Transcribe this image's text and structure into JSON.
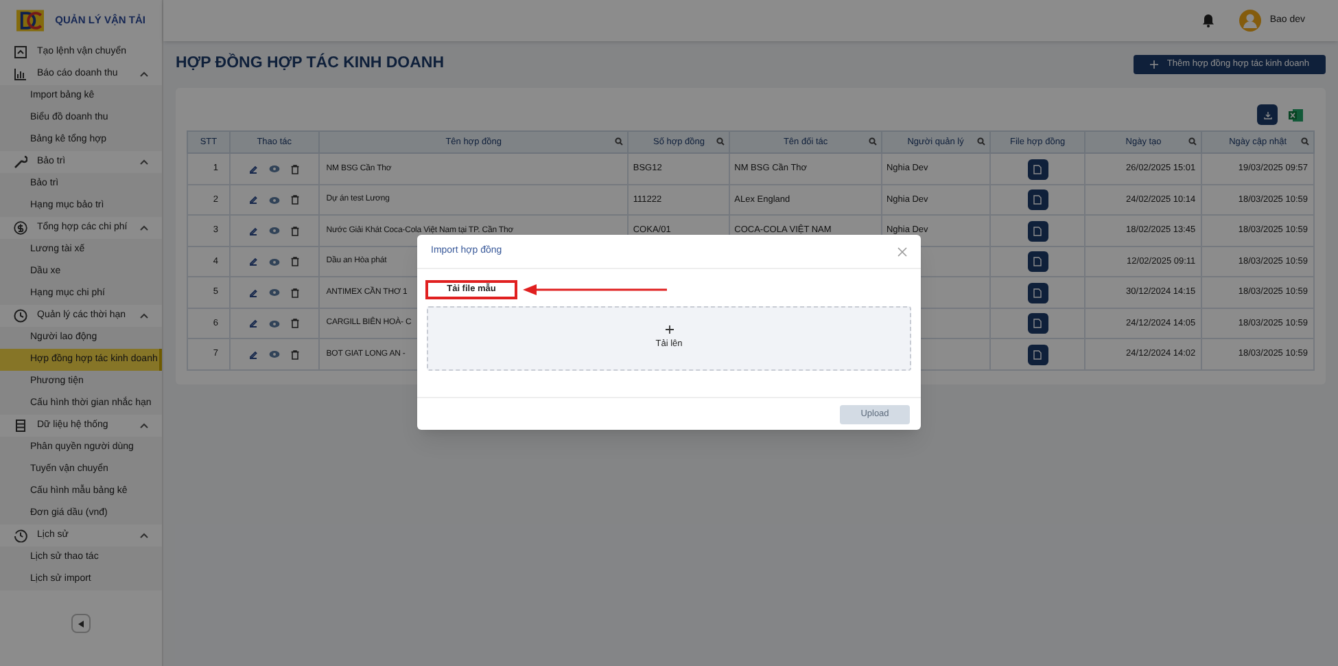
{
  "header": {
    "app_title": "QUẢN LÝ VẬN TẢI",
    "user_name": "Bao dev"
  },
  "sidebar": {
    "items": [
      {
        "kind": "link",
        "label": "Tạo lệnh vận chuyển"
      },
      {
        "kind": "group",
        "label": "Báo cáo doanh thu",
        "expanded": true,
        "children": [
          {
            "label": "Import bảng kê",
            "selected": false
          },
          {
            "label": "Biểu đồ doanh thu",
            "selected": false
          },
          {
            "label": "Bảng kê tổng hợp",
            "selected": false
          }
        ]
      },
      {
        "kind": "group",
        "label": "Bảo trì",
        "expanded": true,
        "children": [
          {
            "label": "Bảo trì",
            "selected": false
          },
          {
            "label": "Hạng mục bảo trì",
            "selected": false
          }
        ]
      },
      {
        "kind": "group",
        "label": "Tổng hợp các chi phí",
        "expanded": true,
        "children": [
          {
            "label": "Lương tài xế",
            "selected": false
          },
          {
            "label": "Dầu xe",
            "selected": false
          },
          {
            "label": "Hạng mục chi phí",
            "selected": false
          }
        ]
      },
      {
        "kind": "group",
        "label": "Quản lý các thời hạn",
        "expanded": true,
        "children": [
          {
            "label": "Người lao động",
            "selected": false
          },
          {
            "label": "Hợp đồng hợp tác kinh doanh",
            "selected": true
          },
          {
            "label": "Phương tiện",
            "selected": false
          },
          {
            "label": "Cấu hình thời gian nhắc hạn",
            "selected": false
          }
        ]
      },
      {
        "kind": "group",
        "label": "Dữ liệu hệ thống",
        "expanded": true,
        "children": [
          {
            "label": "Phân quyền người dùng",
            "selected": false
          },
          {
            "label": "Tuyến vận chuyển",
            "selected": false
          },
          {
            "label": "Cấu hình mẫu bảng kê",
            "selected": false
          },
          {
            "label": "Đơn giá dầu (vnđ)",
            "selected": false
          }
        ]
      },
      {
        "kind": "group",
        "label": "Lịch sử",
        "expanded": true,
        "children": [
          {
            "label": "Lịch sử thao tác",
            "selected": false
          },
          {
            "label": "Lịch sử import",
            "selected": false
          }
        ]
      }
    ]
  },
  "page_title": "HỢP ĐỒNG HỢP TÁC KINH DOANH",
  "add_button": "Thêm hợp đồng hợp tác kinh doanh",
  "table": {
    "columns": [
      {
        "label": "STT",
        "search": false
      },
      {
        "label": "Thao tác",
        "search": false
      },
      {
        "label": "Tên hợp đồng",
        "search": true
      },
      {
        "label": "Số hợp đồng",
        "search": true
      },
      {
        "label": "Tên đối tác",
        "search": true
      },
      {
        "label": "Người quản lý",
        "search": true
      },
      {
        "label": "File hợp đồng",
        "search": false
      },
      {
        "label": "Ngày tạo",
        "search": true
      },
      {
        "label": "Ngày cập nhật",
        "search": true
      }
    ],
    "rows": [
      {
        "stt": "1",
        "name": "NM BSG Cần Thơ",
        "number": "BSG12",
        "partner": "NM BSG Cần Thơ",
        "manager": "Nghia Dev",
        "created": "26/02/2025 15:01",
        "updated": "19/03/2025 09:57"
      },
      {
        "stt": "2",
        "name": "Dự án test Lương",
        "number": "111222",
        "partner": "ALex England",
        "manager": "Nghia Dev",
        "created": "24/02/2025 10:14",
        "updated": "18/03/2025 10:59"
      },
      {
        "stt": "3",
        "name": "Nước Giải Khát Coca-Cola Việt Nam tại TP. Cần Thơ",
        "number": "COKA/01",
        "partner": "COCA-COLA VIỆT NAM",
        "manager": "Nghia Dev",
        "created": "18/02/2025 13:45",
        "updated": "18/03/2025 10:59"
      },
      {
        "stt": "4",
        "name": "Dầu an Hòa phát",
        "created": "12/02/2025 09:11",
        "updated": "18/03/2025 10:59"
      },
      {
        "stt": "5",
        "name": "ANTIMEX CẦN THƠ 1",
        "created": "30/12/2024 14:15",
        "updated": "18/03/2025 10:59"
      },
      {
        "stt": "6",
        "name": "CARGILL BIÊN HOÀ- C",
        "created": "24/12/2024 14:05",
        "updated": "18/03/2025 10:59"
      },
      {
        "stt": "7",
        "name": "BOT GIAT LONG AN -",
        "created": "24/12/2024 14:02",
        "updated": "18/03/2025 10:59"
      }
    ]
  },
  "modal": {
    "title": "Import hợp đồng",
    "template_link": "Tải file mẫu",
    "upload_label": "Tải lên",
    "upload_button": "Upload",
    "upload_disabled": true
  }
}
